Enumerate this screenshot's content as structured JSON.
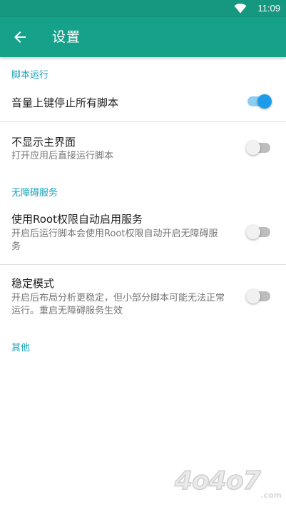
{
  "status_bar": {
    "time": "11:09",
    "icons": [
      "wifi-icon"
    ]
  },
  "toolbar": {
    "back_icon": "arrow-back-icon",
    "title": "设置"
  },
  "sections": {
    "script_run": {
      "header": "脚本运行",
      "items": [
        {
          "title": "音量上键停止所有脚本",
          "summary": "",
          "checked": true
        },
        {
          "title": "不显示主界面",
          "summary": "打开应用后直接运行脚本",
          "checked": false
        }
      ]
    },
    "accessibility": {
      "header": "无障碍服务",
      "items": [
        {
          "title": "使用Root权限自动启用服务",
          "summary": "开启后运行脚本会使用Root权限自动开启无障碍服务",
          "checked": false
        },
        {
          "title": "稳定模式",
          "summary": "开启后布局分析更稳定，但小部分脚本可能无法正常运行。重启无障碍服务生效",
          "checked": false
        }
      ]
    },
    "other": {
      "header": "其他"
    }
  },
  "watermark": {
    "text": "4o4o7",
    "domain": ".com"
  },
  "colors": {
    "toolbar": "#16a28a",
    "status_bar": "#16977f",
    "accent": "#16a2b8",
    "switch_on_thumb": "#1e9be8",
    "switch_on_track": "#8ccdf2",
    "switch_off_thumb": "#f1f1f1",
    "switch_off_track": "#bdbdbd"
  }
}
